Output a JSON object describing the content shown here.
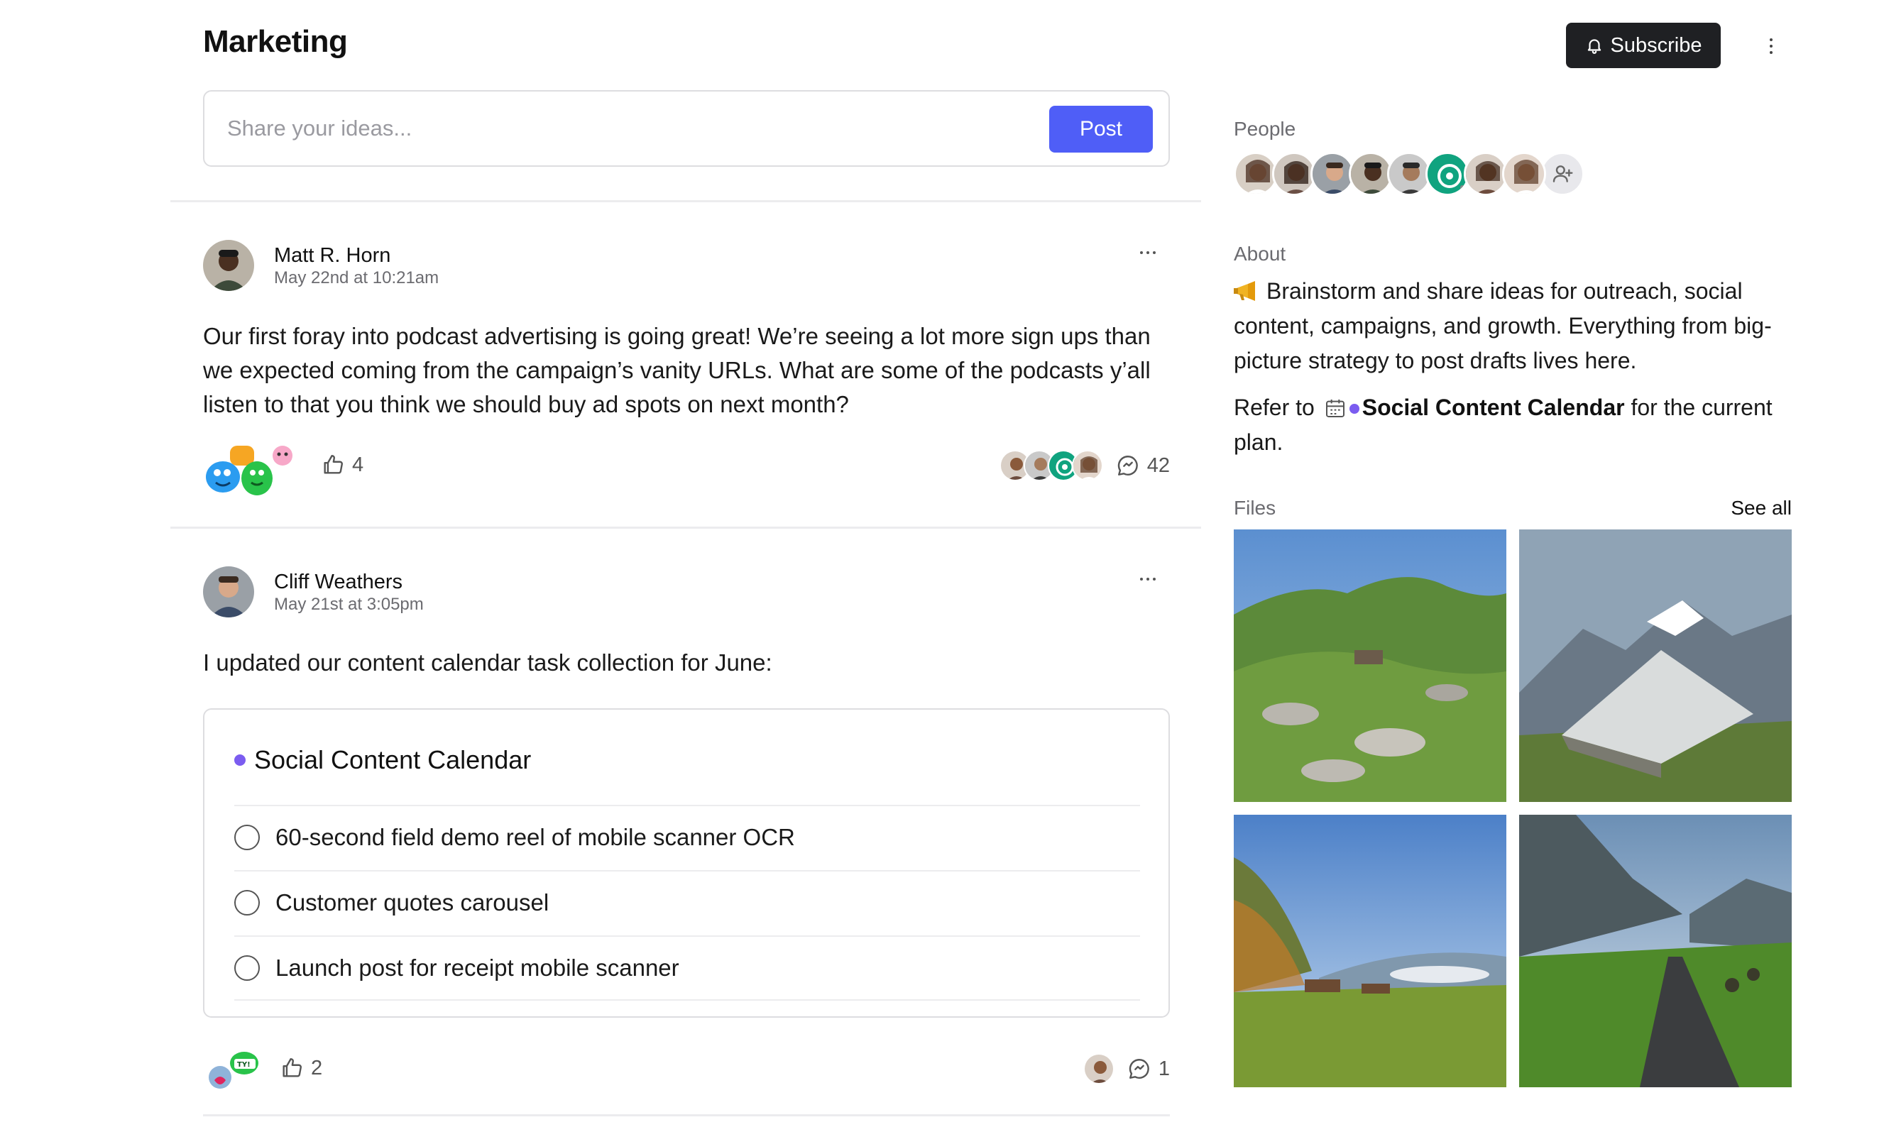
{
  "header": {
    "title": "Marketing",
    "subscribe_label": "Subscribe"
  },
  "composer": {
    "placeholder": "Share your ideas...",
    "post_label": "Post"
  },
  "posts": [
    {
      "author": "Matt R. Horn",
      "timestamp": "May 22nd at 10:21am",
      "body": "Our first foray into podcast advertising is going great! We’re seeing a lot more sign ups than we expected coming from the campaign’s vanity URLs. What are some of the podcasts y’all listen to that you think we should buy ad spots on next month?",
      "likes": "4",
      "comments": "42"
    },
    {
      "author": "Cliff Weathers",
      "timestamp": "May 21st at 3:05pm",
      "body": "I updated our content calendar task collection for June:",
      "task_collection": {
        "title": "Social Content Calendar",
        "tasks": [
          "60-second field demo reel of mobile scanner OCR",
          "Customer quotes carousel",
          "Launch post for receipt mobile scanner"
        ]
      },
      "likes": "2",
      "comments": "1"
    }
  ],
  "sidebar": {
    "people_label": "People",
    "about_label": "About",
    "about_text": "Brainstorm and share ideas for outreach, social content, campaigns, and growth. Everything from big-picture strategy to post drafts lives here.",
    "refer_prefix": "Refer to",
    "refer_link": "Social Content Calendar",
    "refer_suffix": "for the current plan.",
    "files_label": "Files",
    "see_all_label": "See all"
  },
  "colors": {
    "accent": "#4f5ef7",
    "task_dot": "#7b5cf0",
    "dark_button": "#1f2023"
  }
}
